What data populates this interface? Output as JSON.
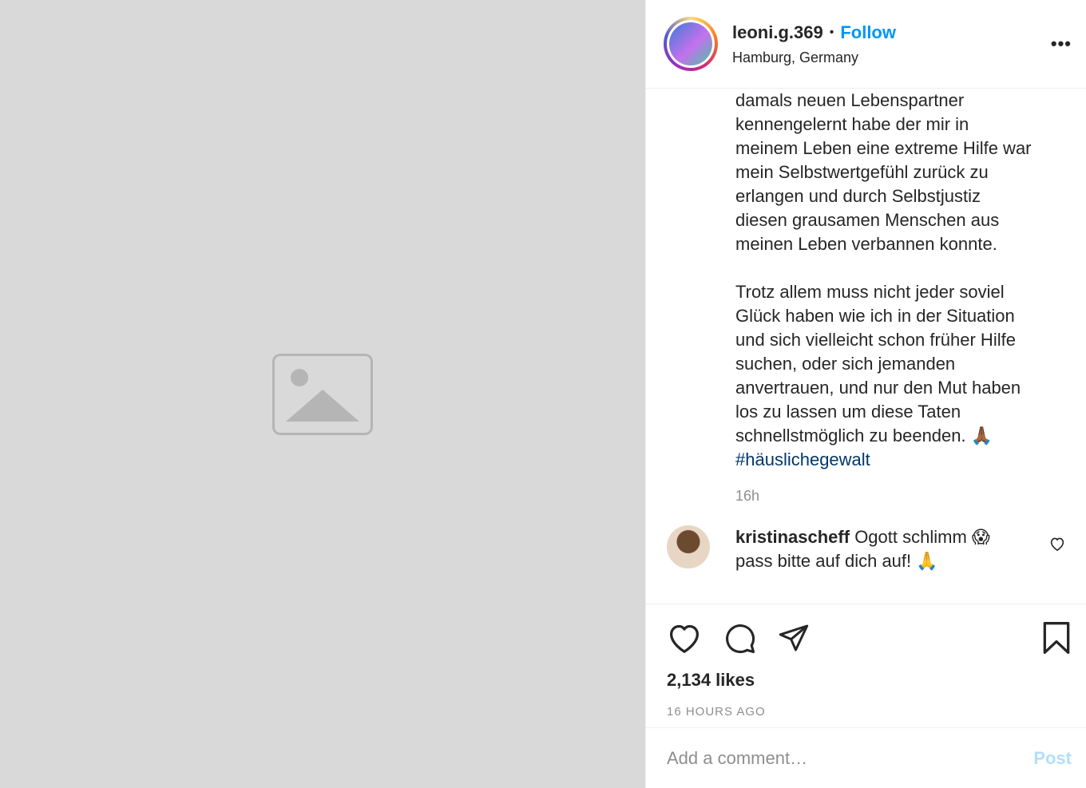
{
  "header": {
    "username": "leoni.g.369",
    "separator": "•",
    "follow_label": "Follow",
    "location": "Hamburg, Germany",
    "more_label": "•••"
  },
  "caption": {
    "text": "damals neuen Lebenspartner\nkennengelernt habe der mir in\nmeinem Leben eine extreme Hilfe war\nmein Selbstwertgefühl zurück zu\nerlangen und durch Selbstjustiz\ndiesen grausamen Menschen aus\nmeinen Leben verbannen konnte.\n\nTrotz allem muss nicht jeder soviel\nGlück haben wie ich in der Situation\nund sich vielleicht schon früher Hilfe\nsuchen, oder sich jemanden\nanvertrauen, und nur den Mut haben\nlos zu lassen um diese Taten\nschnellstmöglich zu beenden. 🙏🏾",
    "hashtag": "#häuslichegewalt",
    "time": "16h"
  },
  "comments": [
    {
      "username": "kristinascheff",
      "text": "Ogott schlimm 😱 pass bitte auf dich auf! 🙏"
    }
  ],
  "actions": {
    "likes": "2,134 likes",
    "time_ago": "16 HOURS AGO"
  },
  "add_comment": {
    "placeholder": "Add a comment…",
    "post_label": "Post"
  },
  "icons": {
    "like": "heart-icon",
    "comment": "comment-icon",
    "share": "share-icon",
    "save": "bookmark-icon",
    "comment_like": "small-heart-icon"
  }
}
